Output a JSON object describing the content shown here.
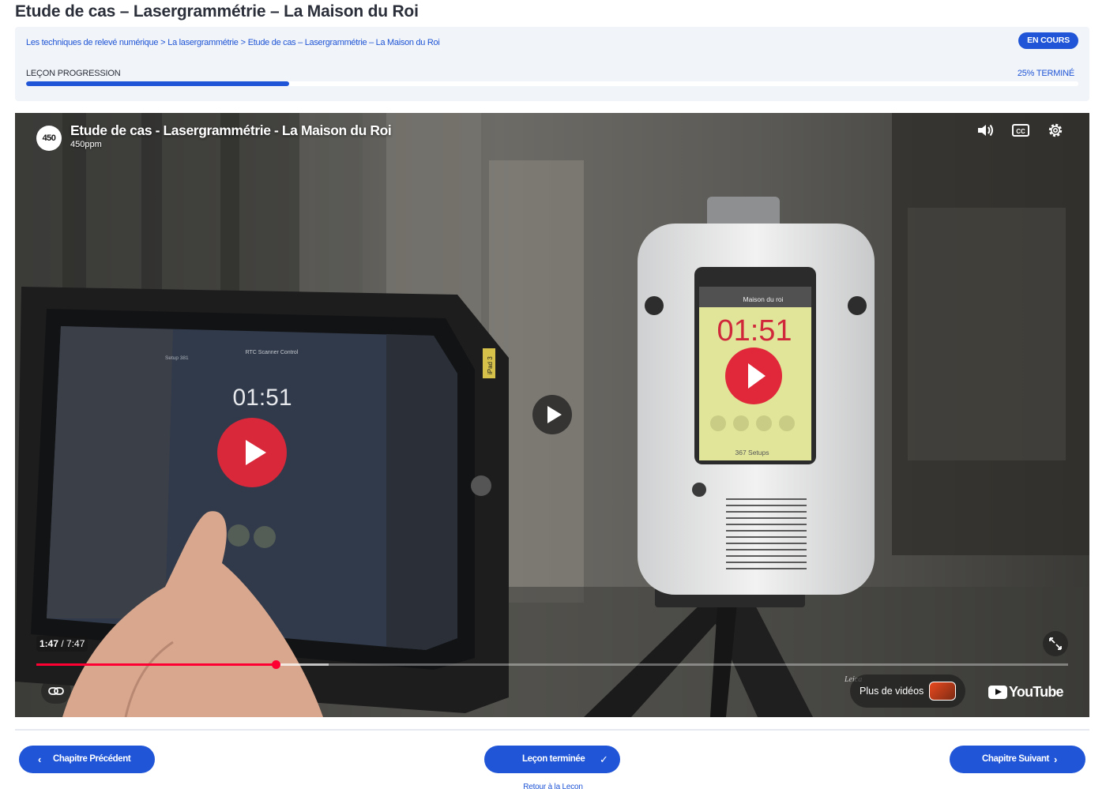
{
  "page": {
    "title": "Etude de cas – Lasergrammétrie – La Maison du Roi"
  },
  "breadcrumb": {
    "items": [
      "Les techniques de relevé numérique",
      "La lasergrammétrie",
      "Etude de cas – Lasergrammétrie – La Maison du Roi"
    ],
    "separator": ">"
  },
  "status_badge": "EN COURS",
  "progress": {
    "label": "LEÇON PROGRESSION",
    "percent_text": "25% TERMINÉ",
    "value": 0.25
  },
  "video": {
    "logo_text": "450",
    "title": "Etude de cas - Lasergrammétrie - La Maison du Roi",
    "channel": "450ppm",
    "current_time": "1:47",
    "duration": "7:47",
    "played_fraction": 0.232,
    "buffered_fraction": 0.283,
    "more_videos_label": "Plus de vidéos",
    "youtube_label": "YouTube",
    "tablet_timer": "01:51",
    "scanner_timer": "01:51",
    "scanner_screen_title": "Maison du roi",
    "scanner_setups": "367 Setups",
    "tablet_side_label": "iPad 3",
    "tablet_app_title": "RTC Scanner Control",
    "tablet_setup_label": "Setup 381",
    "scanner_brand": "Leica",
    "colors": {
      "seek": "#ff0033",
      "play_red": "#e0283a"
    }
  },
  "nav": {
    "prev_label": "Chapitre Précédent",
    "complete_label": "Leçon terminée",
    "next_label": "Chapitre Suivant",
    "back_label": "Retour à la Leçon"
  },
  "colors": {
    "accent": "#1f55d6",
    "card_bg": "#f1f4f8"
  }
}
